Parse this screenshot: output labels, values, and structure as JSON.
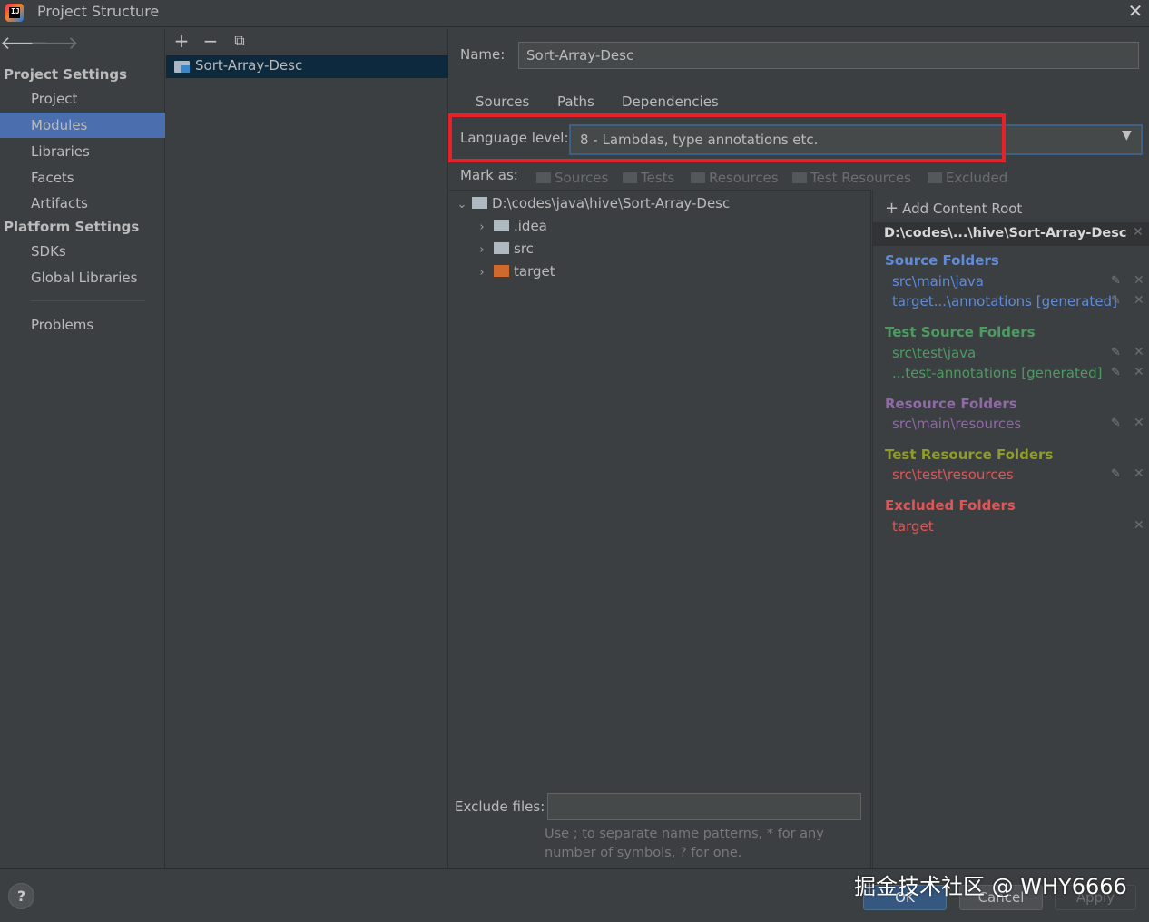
{
  "window": {
    "title": "Project Structure"
  },
  "colors": {
    "accent": "#4b6eaf",
    "highlight_box": "#e8202a",
    "source_folders": "#5f8bd8",
    "test_source_folders": "#4e9a63",
    "resource_folders": "#8f6aa6",
    "test_resource_folders": "#8f9b2b",
    "excluded_folders": "#e05555"
  },
  "sidebar": {
    "project_settings": "Project Settings",
    "items": [
      "Project",
      "Modules",
      "Libraries",
      "Facets",
      "Artifacts"
    ],
    "platform_settings": "Platform Settings",
    "platform_items": [
      "SDKs",
      "Global Libraries"
    ],
    "problems": "Problems",
    "selected": "Modules"
  },
  "modules": {
    "list": [
      "Sort-Array-Desc"
    ]
  },
  "module_detail": {
    "name_label": "Name:",
    "name_value": "Sort-Array-Desc",
    "tabs": [
      "Sources",
      "Paths",
      "Dependencies"
    ],
    "language_level_label": "Language level:",
    "language_level_value": "8 - Lambdas, type annotations etc.",
    "mark_as_label": "Mark as:",
    "mark_as_options": [
      "Sources",
      "Tests",
      "Resources",
      "Test Resources",
      "Excluded"
    ],
    "tree": {
      "root": "D:\\codes\\java\\hive\\Sort-Array-Desc",
      "children": [
        ".idea",
        "src",
        "target"
      ]
    },
    "exclude_files_label": "Exclude files:",
    "exclude_files_value": "",
    "exclude_hint": "Use ; to separate name patterns, * for any number of symbols, ? for one."
  },
  "content_roots": {
    "add_label": "Add Content Root",
    "root": "D:\\codes\\...\\hive\\Sort-Array-Desc",
    "source_folders": {
      "title": "Source Folders",
      "items": [
        "src\\main\\java",
        "target...\\annotations [generated]"
      ]
    },
    "test_source_folders": {
      "title": "Test Source Folders",
      "items": [
        "src\\test\\java",
        "...test-annotations [generated]"
      ]
    },
    "resource_folders": {
      "title": "Resource Folders",
      "items": [
        "src\\main\\resources"
      ]
    },
    "test_resource_folders": {
      "title": "Test Resource Folders",
      "items": [
        "src\\test\\resources"
      ]
    },
    "excluded_folders": {
      "title": "Excluded Folders",
      "items": [
        "target"
      ]
    }
  },
  "buttons": {
    "help": "?",
    "ok": "OK",
    "cancel": "Cancel",
    "apply": "Apply"
  },
  "watermark": "掘金技术社区 @ WHY6666"
}
